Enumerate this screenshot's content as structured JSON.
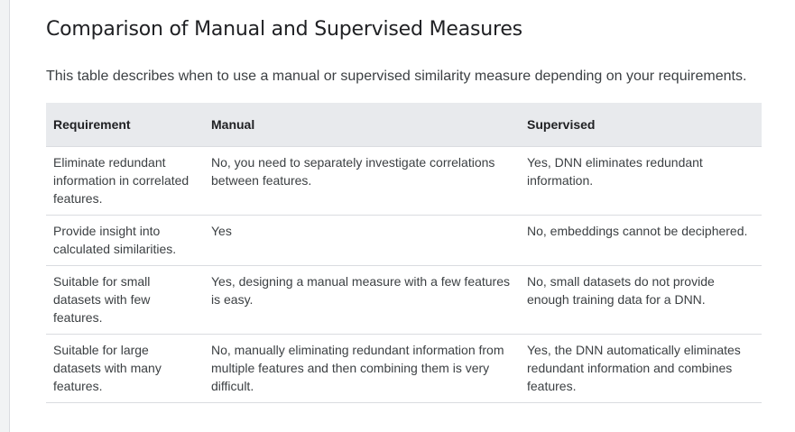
{
  "page": {
    "title": "Comparison of Manual and Supervised Measures",
    "description": "This table describes when to use a manual or supervised similarity measure depending on your requirements."
  },
  "table": {
    "headers": [
      "Requirement",
      "Manual",
      "Supervised"
    ],
    "rows": [
      [
        "Eliminate redundant information in correlated features.",
        "No, you need to separately investigate correlations between features.",
        "Yes, DNN eliminates redundant information."
      ],
      [
        "Provide insight into calculated similarities.",
        "Yes",
        "No, embeddings cannot be deciphered."
      ],
      [
        "Suitable for small datasets with few features.",
        "Yes, designing a manual measure with a few features is easy.",
        "No, small datasets do not provide enough training data for a DNN."
      ],
      [
        "Suitable for large datasets with many features.",
        "No, manually eliminating redundant information from multiple features and then combining them is very difficult.",
        "Yes, the DNN automatically eliminates redundant information and combines features."
      ]
    ]
  }
}
